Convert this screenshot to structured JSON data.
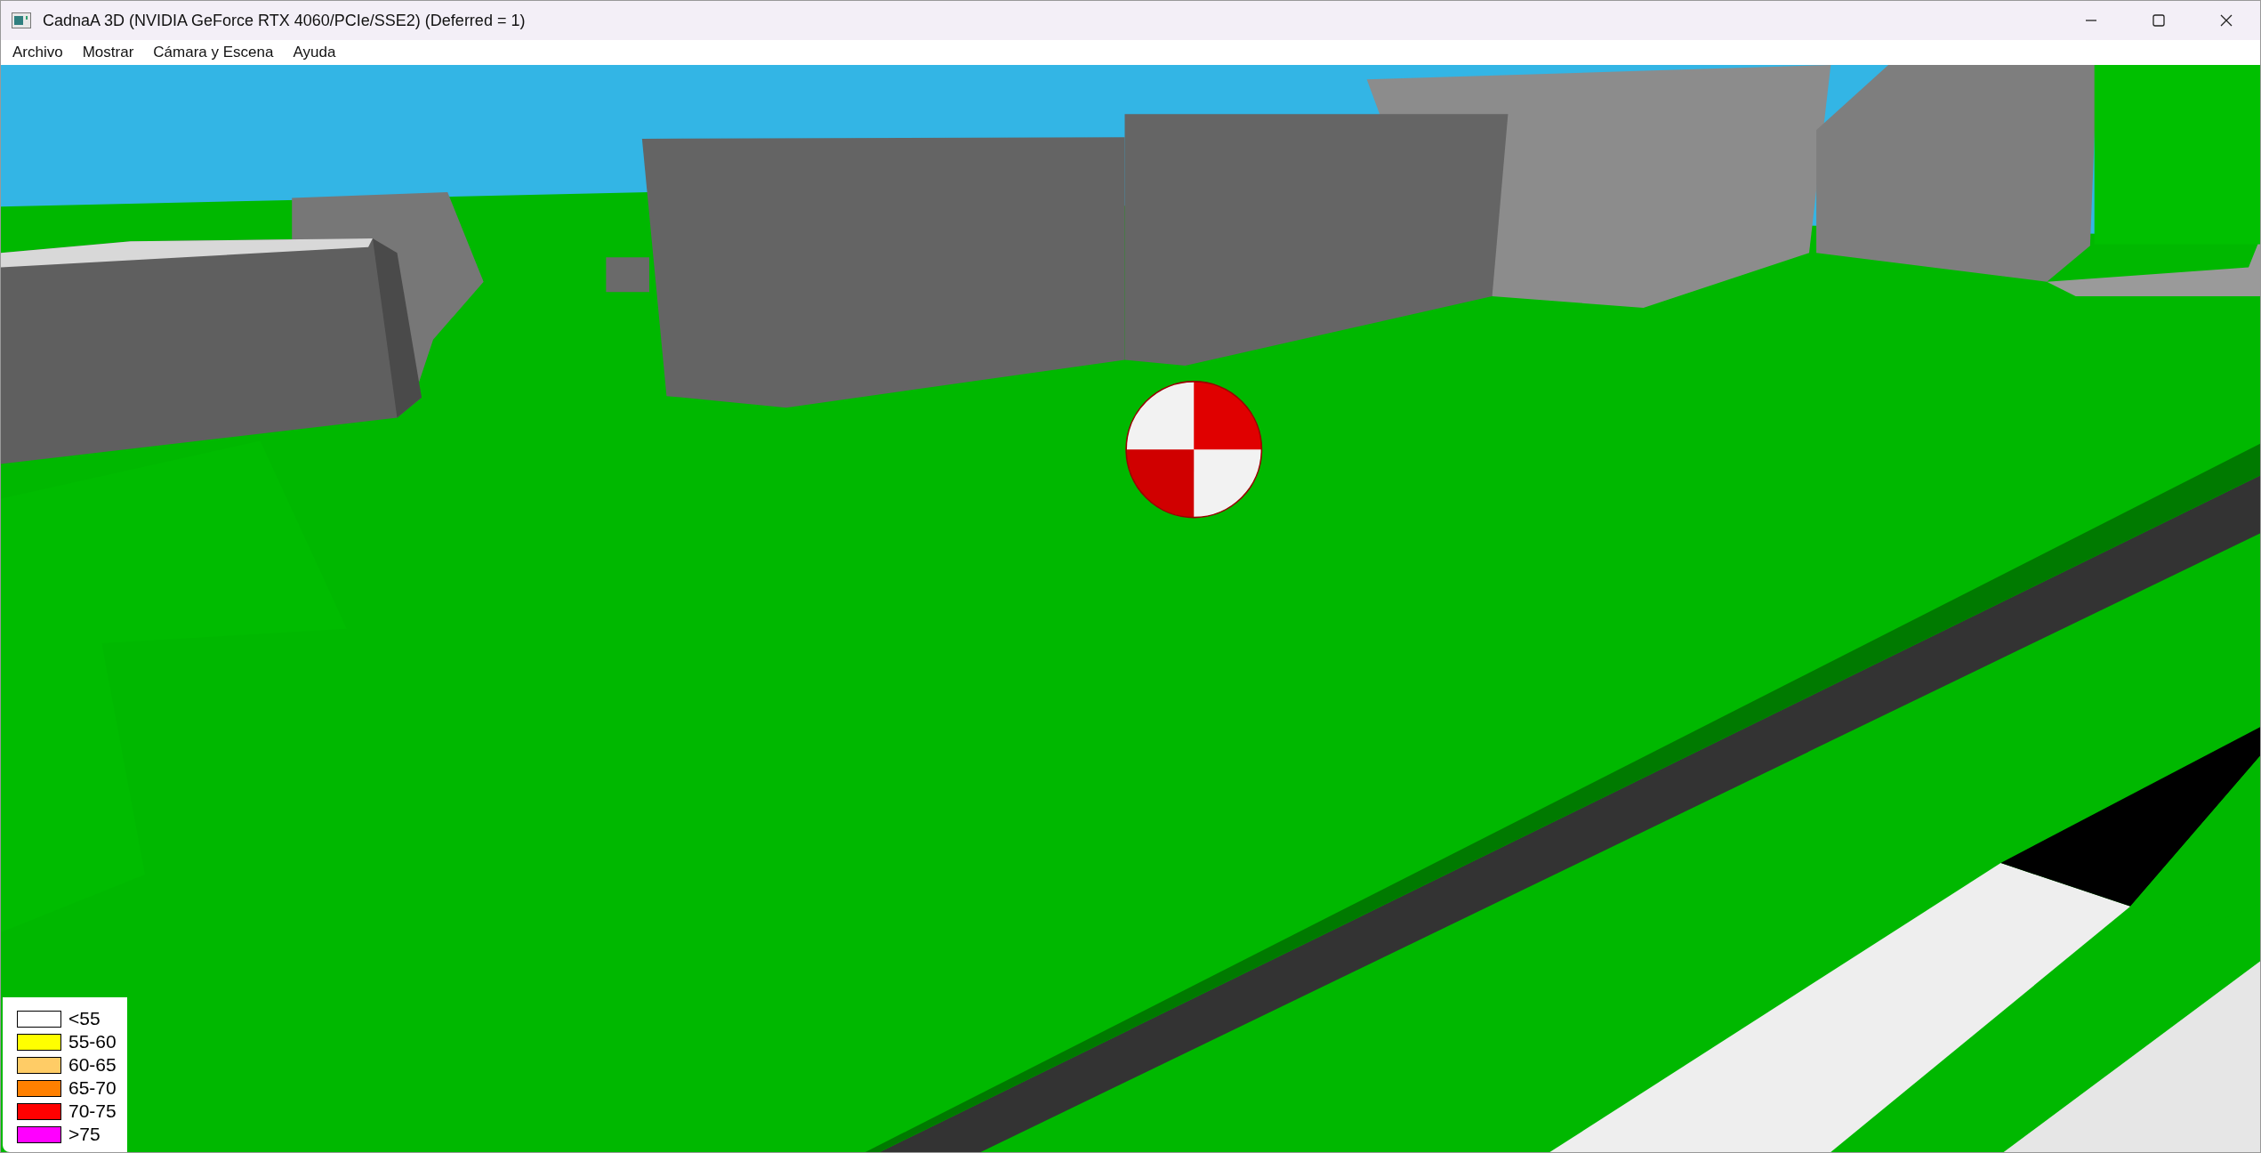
{
  "window": {
    "title": "CadnaA 3D (NVIDIA GeForce RTX 4060/PCIe/SSE2) (Deferred = 1)"
  },
  "menu": [
    "Archivo",
    "Mostrar",
    "Cámara y Escena",
    "Ayuda"
  ],
  "legend": [
    {
      "label": "<55",
      "color": "#ffffff"
    },
    {
      "label": "55-60",
      "color": "#ffff00"
    },
    {
      "label": "60-65",
      "color": "#ffcc66"
    },
    {
      "label": "65-70",
      "color": "#ff8000"
    },
    {
      "label": "70-75",
      "color": "#ff0000"
    },
    {
      "label": ">75",
      "color": "#ff00ff"
    }
  ]
}
